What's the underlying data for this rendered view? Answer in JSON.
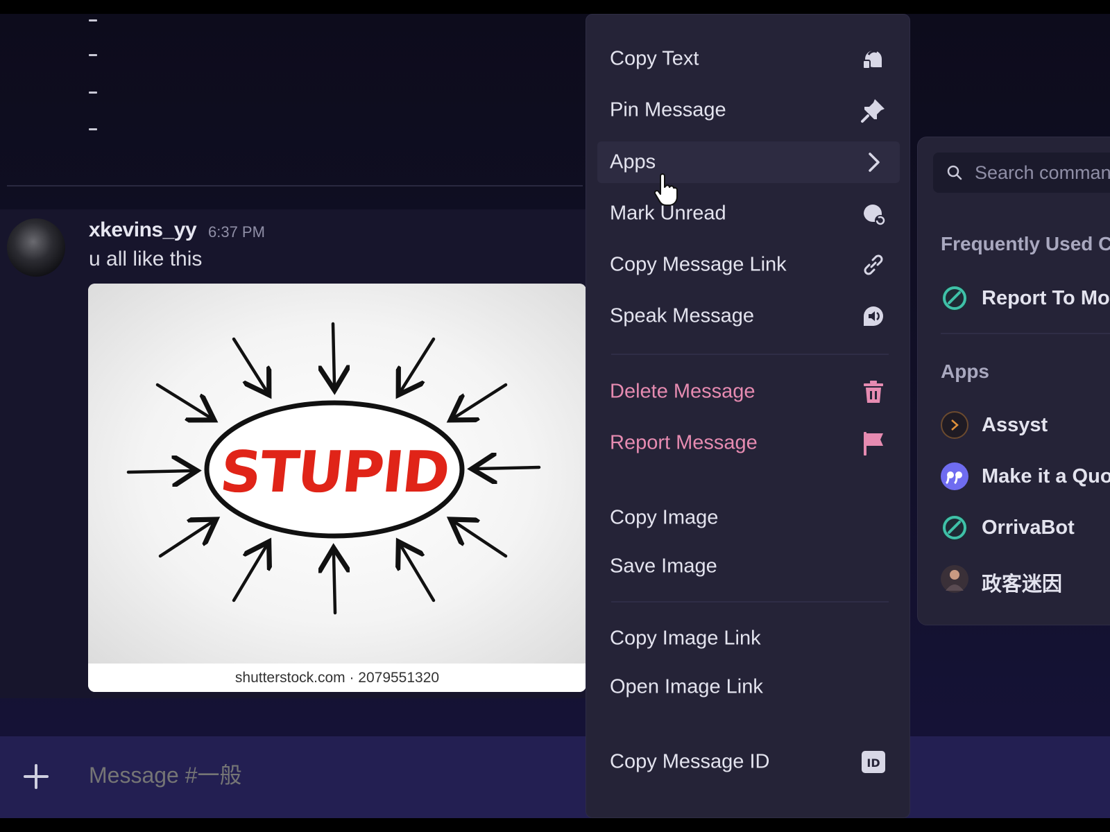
{
  "message": {
    "username": "xkevins_yy",
    "timestamp": "6:37 PM",
    "text": "u all like this",
    "attachment": {
      "caption_word": "STUPID",
      "credit": "shutterstock.com · 2079551320"
    }
  },
  "composer": {
    "placeholder": "Message #一般"
  },
  "context_menu": {
    "items": [
      {
        "label": "Copy Text",
        "icon": "copy-text-icon"
      },
      {
        "label": "Pin Message",
        "icon": "pin-icon"
      },
      {
        "label": "Apps",
        "icon": "chevron-right-icon"
      },
      {
        "label": "Mark Unread",
        "icon": "mark-unread-icon"
      },
      {
        "label": "Copy Message Link",
        "icon": "link-icon"
      },
      {
        "label": "Speak Message",
        "icon": "speaker-icon"
      },
      {
        "label": "Delete Message",
        "icon": "trash-icon"
      },
      {
        "label": "Report Message",
        "icon": "flag-icon"
      },
      {
        "label": "Copy Image",
        "icon": ""
      },
      {
        "label": "Save Image",
        "icon": ""
      },
      {
        "label": "Copy Image Link",
        "icon": ""
      },
      {
        "label": "Open Image Link",
        "icon": ""
      },
      {
        "label": "Copy Message ID",
        "icon": "id-icon"
      }
    ],
    "danger_color": "#e68bb1"
  },
  "apps_panel": {
    "search_placeholder": "Search comman",
    "frequently_used_heading": "Frequently Used Co",
    "frequently_used": [
      {
        "label": "Report To Mod",
        "icon": "orrivabot-icon"
      }
    ],
    "apps_heading": "Apps",
    "apps": [
      {
        "label": "Assyst",
        "icon": "assyst-icon"
      },
      {
        "label": "Make it a Quote",
        "icon": "quote-icon"
      },
      {
        "label": "OrrivaBot",
        "icon": "orrivabot-icon"
      },
      {
        "label": "政客迷因",
        "icon": "app-avatar-icon"
      }
    ]
  },
  "colors": {
    "menu_bg": "#252337",
    "accent_teal": "#3fc1a8",
    "quote_purple": "#6f6cf0",
    "composer_bg": "#231f52"
  }
}
